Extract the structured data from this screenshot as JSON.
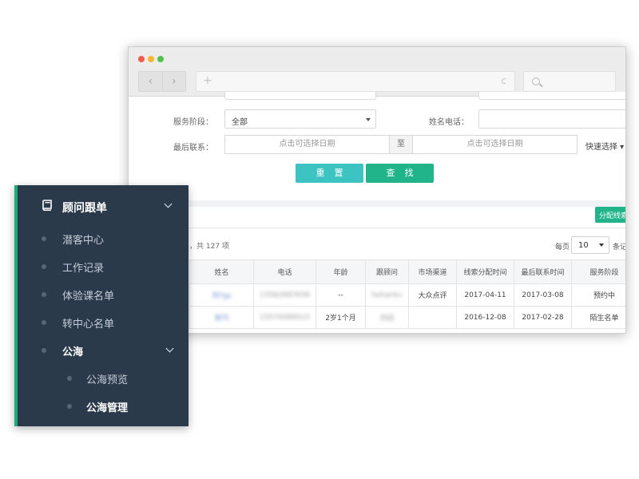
{
  "browser": {
    "nav": {
      "back": "‹",
      "forward": "›"
    },
    "url": {
      "plus": "+",
      "reload": "c"
    }
  },
  "filters": {
    "stage_label": "服务阶段：",
    "stage_value": "全部",
    "name_phone_label": "姓名电话：",
    "last_contact_label": "最后联系：",
    "date_placeholder_start": "点击可选择日期",
    "date_separator": "至",
    "date_placeholder_end": "点击可选择日期",
    "quick_select": "快速选择 ▾"
  },
  "actions": {
    "reset": "重置",
    "search": "查找",
    "assign": "分配线索"
  },
  "list": {
    "total_text": "，共 127 项",
    "per_page_label": "每页",
    "per_page_value": "10",
    "per_page_suffix": "条记录"
  },
  "table": {
    "headers": [
      "姓名",
      "电话",
      "年龄",
      "跟顾问",
      "市场渠道",
      "线索分配时间",
      "最后联系时间",
      "服务阶段"
    ],
    "rows": [
      [
        "刘?gs",
        "13582687656",
        "--",
        "hehankv",
        "大众点评",
        "2017-04-11",
        "2017-03-08",
        "预约中"
      ],
      [
        "张巧",
        "15570089515",
        "2岁1个月",
        "刘迈",
        "",
        "2016-12-08",
        "2017-02-28",
        "陌生名单"
      ]
    ]
  },
  "sidebar": {
    "title": "顾问跟单",
    "items": [
      {
        "label": "潜客中心"
      },
      {
        "label": "工作记录"
      },
      {
        "label": "体验课名单"
      },
      {
        "label": "转中心名单"
      },
      {
        "label": "公海"
      }
    ],
    "subitems": [
      {
        "label": "公海预览"
      },
      {
        "label": "公海管理"
      }
    ]
  },
  "colors": {
    "sidebar_bg": "#2b3a4b",
    "accent_green": "#1aaa7b",
    "reset_btn": "#3cc3c2",
    "search_btn": "#21b38a"
  }
}
